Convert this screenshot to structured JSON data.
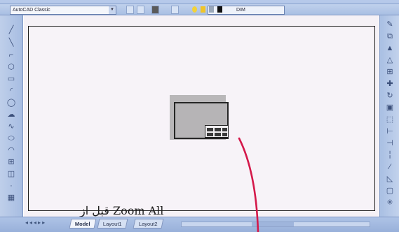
{
  "toolbar": {
    "workspace": "AutoCAD Classic",
    "layer": "DIM"
  },
  "tabs": [
    {
      "label": "Model",
      "active": true
    },
    {
      "label": "Layout1",
      "active": false
    },
    {
      "label": "Layout2",
      "active": false
    }
  ],
  "caption": "قبل از Zoom All",
  "colors": {
    "drawing_background": "#f5f1f6",
    "toolbar": "#b4c7e7",
    "pointer_arrow": "#d4184a"
  },
  "icons": {
    "left": [
      "line-icon",
      "construction-line-icon",
      "polyline-icon",
      "polygon-icon",
      "rectangle-icon",
      "arc-icon",
      "circle-icon",
      "revision-cloud-icon",
      "spline-icon",
      "ellipse-icon",
      "ellipse-arc-icon",
      "insert-block-icon",
      "make-block-icon",
      "point-icon",
      "hatch-icon"
    ],
    "right": [
      "erase-icon",
      "copy-icon",
      "mirror-icon",
      "offset-icon",
      "array-icon",
      "move-icon",
      "rotate-icon",
      "scale-icon",
      "stretch-icon",
      "trim-icon",
      "extend-icon",
      "break-icon",
      "join-icon",
      "chamfer-icon",
      "fillet-icon",
      "explode-icon"
    ]
  }
}
